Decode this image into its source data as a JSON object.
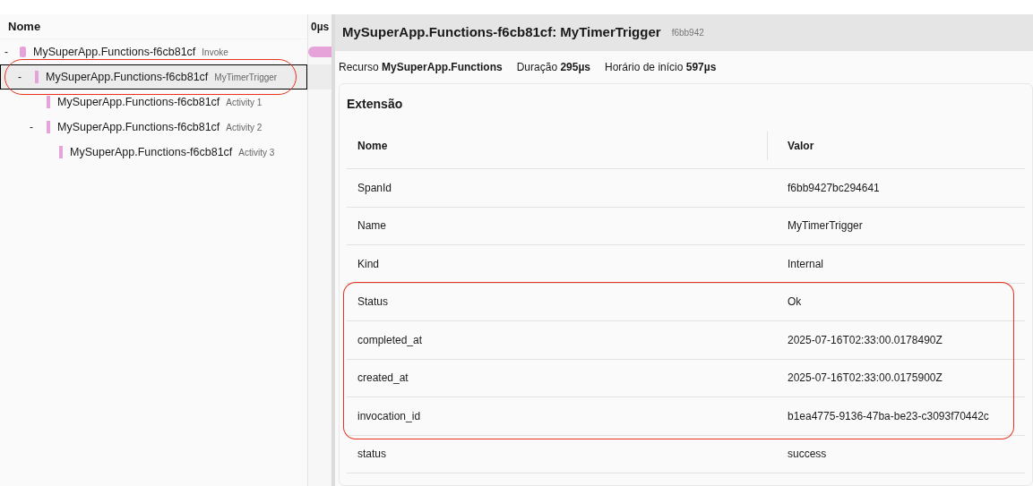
{
  "tree": {
    "column": "Nome",
    "timeline_header": "0µs",
    "items": [
      {
        "kind": "resource",
        "name": "MySuperApp.Functions-f6cb81cf",
        "tag": "Invoke",
        "toggle": "-",
        "selected": false,
        "circled": false,
        "children": [
          {
            "kind": "span",
            "name": "MySuperApp.Functions-f6cb81cf",
            "tag": "MyTimerTrigger",
            "toggle": "-",
            "selected": true,
            "circled": true,
            "children": [
              {
                "kind": "span",
                "name": "MySuperApp.Functions-f6cb81cf",
                "tag": "Activity 1",
                "selected": false,
                "circled": false
              },
              {
                "kind": "span",
                "name": "MySuperApp.Functions-f6cb81cf",
                "tag": "Activity 2",
                "toggle": "-",
                "selected": false,
                "circled": false,
                "children": [
                  {
                    "kind": "span",
                    "name": "MySuperApp.Functions-f6cb81cf",
                    "tag": "Activity 3",
                    "selected": false,
                    "circled": false
                  }
                ]
              }
            ]
          }
        ]
      }
    ]
  },
  "detail": {
    "title": "MySuperApp.Functions-f6cb81cf: MyTimerTrigger",
    "id": "f6bb942",
    "info": [
      {
        "label": "Recurso",
        "value": "MySuperApp.Functions"
      },
      {
        "label": "Duração",
        "value": "295µs"
      },
      {
        "label": "Horário de início",
        "value": "597µs"
      }
    ],
    "section": "Extensão",
    "columns": [
      "Nome",
      "Valor"
    ],
    "rows": [
      {
        "name": "SpanId",
        "value": "f6bb9427bc294641",
        "circled": false
      },
      {
        "name": "Name",
        "value": "MyTimerTrigger",
        "circled": false
      },
      {
        "name": "Kind",
        "value": "Internal",
        "circled": false
      },
      {
        "name": "Status",
        "value": "Ok",
        "circled": true
      },
      {
        "name": "completed_at",
        "value": "2025-07-16T02:33:00.0178490Z",
        "circled": true
      },
      {
        "name": "created_at",
        "value": "2025-07-16T02:33:00.0175900Z",
        "circled": true
      },
      {
        "name": "invocation_id",
        "value": "b1ea4775-9136-47ba-be23-c3093f70442c",
        "circled": true
      },
      {
        "name": "status",
        "value": "success",
        "circled": false
      }
    ]
  }
}
